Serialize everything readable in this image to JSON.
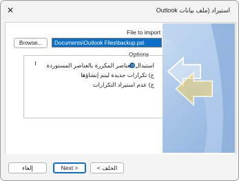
{
  "window": {
    "title": "استيراد (ملف بيانات Outlook",
    "close_glyph": "✕"
  },
  "form": {
    "file_label": "File to import",
    "path_value": "Documents\\Outlook Files\\backup.pst",
    "browse_label": "Browse..."
  },
  "options": {
    "label": "Options",
    "items": [
      {
        "label": "استبدال العناصر المكررة بالعناصر المستوردة",
        "selected": true
      },
      {
        "label": "ج) تكرارات جديدة ليتم إنشاؤها",
        "selected": false
      },
      {
        "label": "ج) عدم استيراد التكرارات",
        "selected": false
      }
    ]
  },
  "footer": {
    "back_label": "< الخلف",
    "next_label": "Next >",
    "cancel_label": "إلغاء"
  },
  "colors": {
    "accent": "#0b6fc7",
    "banner_light": "#cfe0f3",
    "banner_dark": "#8fb2df"
  }
}
